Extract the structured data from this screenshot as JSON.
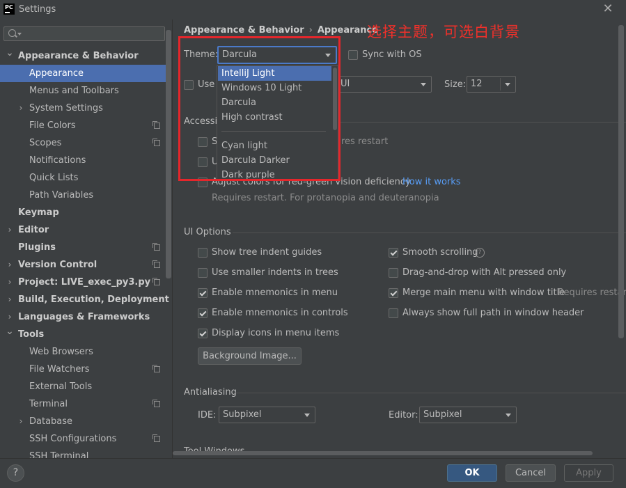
{
  "window": {
    "title": "Settings",
    "logo_text": "PC",
    "close_glyph": "✕"
  },
  "annotation": "选择主题，可选白背景",
  "sidebar": {
    "search_placeholder": "",
    "items": [
      {
        "label": "Appearance & Behavior",
        "level": 0,
        "bold": true,
        "expanded": true
      },
      {
        "label": "Appearance",
        "level": 1,
        "selected": true
      },
      {
        "label": "Menus and Toolbars",
        "level": 1
      },
      {
        "label": "System Settings",
        "level": 1,
        "collapsed": true
      },
      {
        "label": "File Colors",
        "level": 1,
        "project": true
      },
      {
        "label": "Scopes",
        "level": 1,
        "project": true
      },
      {
        "label": "Notifications",
        "level": 1
      },
      {
        "label": "Quick Lists",
        "level": 1
      },
      {
        "label": "Path Variables",
        "level": 1
      },
      {
        "label": "Keymap",
        "level": 0,
        "bold": true
      },
      {
        "label": "Editor",
        "level": 0,
        "bold": true,
        "collapsed": true
      },
      {
        "label": "Plugins",
        "level": 0,
        "bold": true,
        "project": true
      },
      {
        "label": "Version Control",
        "level": 0,
        "bold": true,
        "collapsed": true,
        "project": true
      },
      {
        "label": "Project: LIVE_exec_py3.py",
        "level": 0,
        "bold": true,
        "collapsed": true,
        "project": true
      },
      {
        "label": "Build, Execution, Deployment",
        "level": 0,
        "bold": true,
        "collapsed": true
      },
      {
        "label": "Languages & Frameworks",
        "level": 0,
        "bold": true,
        "collapsed": true
      },
      {
        "label": "Tools",
        "level": 0,
        "bold": true,
        "expanded": true
      },
      {
        "label": "Web Browsers",
        "level": 1
      },
      {
        "label": "File Watchers",
        "level": 1,
        "project": true
      },
      {
        "label": "External Tools",
        "level": 1
      },
      {
        "label": "Terminal",
        "level": 1,
        "project": true
      },
      {
        "label": "Database",
        "level": 1,
        "collapsed": true
      },
      {
        "label": "SSH Configurations",
        "level": 1,
        "project": true
      },
      {
        "label": "SSH Terminal",
        "level": 1
      }
    ]
  },
  "breadcrumb": {
    "parent": "Appearance & Behavior",
    "sep": "›",
    "current": "Appearance"
  },
  "theme": {
    "label": "Theme:",
    "value": "Darcula",
    "sync_label": "Sync with OS",
    "sync_checked": false,
    "options_group1": [
      "IntelliJ Light",
      "Windows 10 Light",
      "Darcula",
      "High contrast"
    ],
    "options_group2": [
      "Cyan light",
      "Darcula Darker",
      "Dark purple"
    ],
    "selected_option": "IntelliJ Light"
  },
  "font": {
    "use_label": "Use",
    "font_value": "UI",
    "size_label": "Size:",
    "size_value": "12"
  },
  "accessibility": {
    "section_label": "Accessi",
    "row1_prefix": "S",
    "row1_suffix": "res restart",
    "row2_prefix": "U",
    "adjust_label": "Adjust colors for red-green vision deficiency",
    "how_it_works": "How it works",
    "adjust_note": "Requires restart. For protanopia and deuteranopia"
  },
  "ui_options": {
    "section_label": "UI Options",
    "left": [
      {
        "label": "Show tree indent guides",
        "checked": false
      },
      {
        "label": "Use smaller indents in trees",
        "checked": false
      },
      {
        "label": "Enable mnemonics in menu",
        "checked": true
      },
      {
        "label": "Enable mnemonics in controls",
        "checked": true
      },
      {
        "label": "Display icons in menu items",
        "checked": true
      }
    ],
    "right": [
      {
        "label": "Smooth scrolling",
        "checked": true
      },
      {
        "label": "Drag-and-drop with Alt pressed only",
        "checked": false
      },
      {
        "label": "Merge main menu with window title",
        "checked": true
      },
      {
        "label": "Always show full path in window header",
        "checked": false
      }
    ],
    "requires_restart": "Requires restart",
    "help_glyph": "?",
    "background_button": "Background Image..."
  },
  "antialiasing": {
    "section_label": "Antialiasing",
    "ide_label": "IDE:",
    "ide_value": "Subpixel",
    "editor_label": "Editor:",
    "editor_value": "Subpixel"
  },
  "tool_windows": {
    "section_label": "Tool Windows"
  },
  "buttons": {
    "ok": "OK",
    "cancel": "Cancel",
    "apply": "Apply",
    "help": "?"
  },
  "colors": {
    "selection": "#4b6eaf",
    "annotation_red": "#e5262b",
    "link": "#589df6",
    "background": "#3c3f41"
  }
}
